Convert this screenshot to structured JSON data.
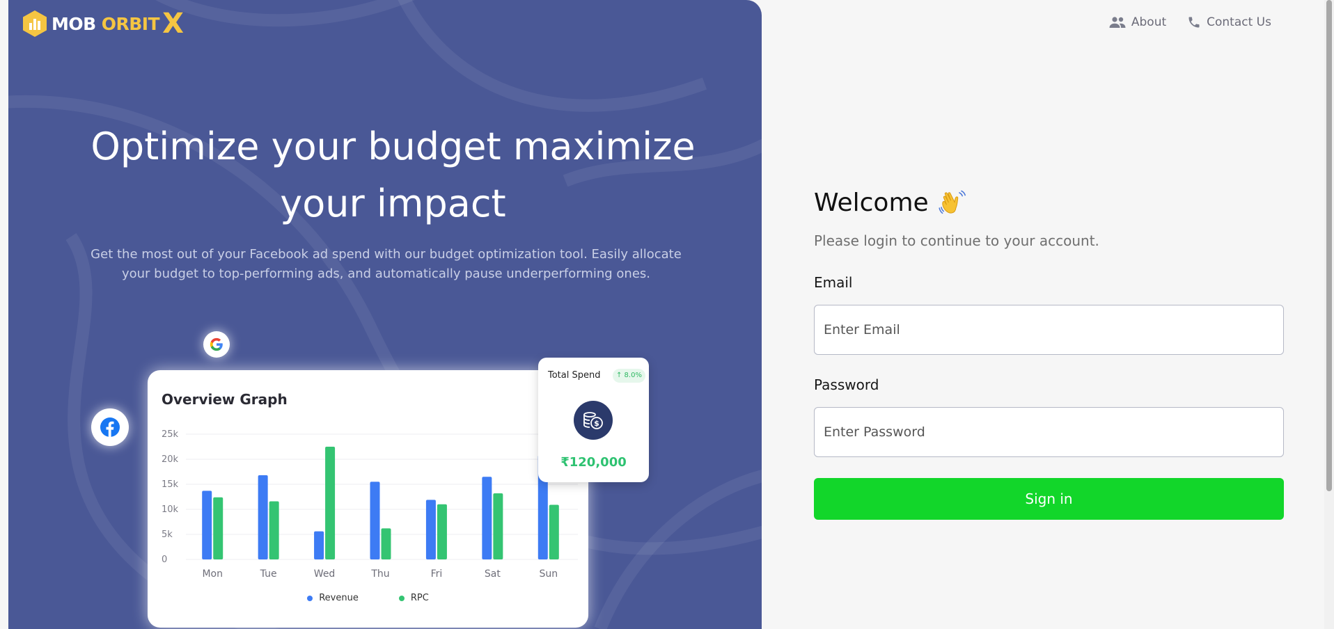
{
  "brand": {
    "part1": "MOB",
    "part2": "ORBIT",
    "part3": "X",
    "accent_color": "#f5c542"
  },
  "nav": {
    "about": {
      "label": "About",
      "icon": "people-icon"
    },
    "contact": {
      "label": "Contact Us",
      "icon": "phone-icon"
    }
  },
  "hero": {
    "title_line1": "Optimize your budget maximize",
    "title_line2": "your impact",
    "subtitle": "Get the most out of your Facebook ad spend with our budget optimization tool. Easily allocate your budget to top-performing ads, and automatically pause underperforming ones.",
    "background_color": "#4a5896",
    "badges": [
      "google-icon",
      "facebook-icon"
    ]
  },
  "graph_card": {
    "title": "Overview Graph",
    "legend": [
      "Revenue",
      "RPC"
    ]
  },
  "spend_card": {
    "label": "Total Spend",
    "change": "↑ 8.0%",
    "value": "₹120,000",
    "icon": "coins-icon"
  },
  "chart_data": {
    "type": "bar",
    "title": "Overview Graph",
    "categories": [
      "Mon",
      "Tue",
      "Wed",
      "Thu",
      "Fri",
      "Sat",
      "Sun"
    ],
    "series": [
      {
        "name": "Revenue",
        "color": "#3d7bf4",
        "values": [
          13700,
          16800,
          5600,
          15500,
          11900,
          16500,
          20800
        ]
      },
      {
        "name": "RPC",
        "color": "#34c472",
        "values": [
          12400,
          11600,
          22500,
          6200,
          11000,
          13200,
          10900
        ]
      }
    ],
    "ylim": [
      0,
      25000
    ],
    "yticks": [
      "0",
      "5k",
      "10k",
      "15k",
      "20k",
      "25k"
    ],
    "grid": true,
    "legend_position": "bottom"
  },
  "login": {
    "welcome": "Welcome",
    "welcome_icon": "waving-hand-icon",
    "subtitle": "Please login to continue to your account.",
    "email_label": "Email",
    "email_placeholder": "Enter Email",
    "email_value": "",
    "password_label": "Password",
    "password_placeholder": "Enter Password",
    "password_value": "",
    "signin_label": "Sign in",
    "button_color": "#12d62a"
  }
}
